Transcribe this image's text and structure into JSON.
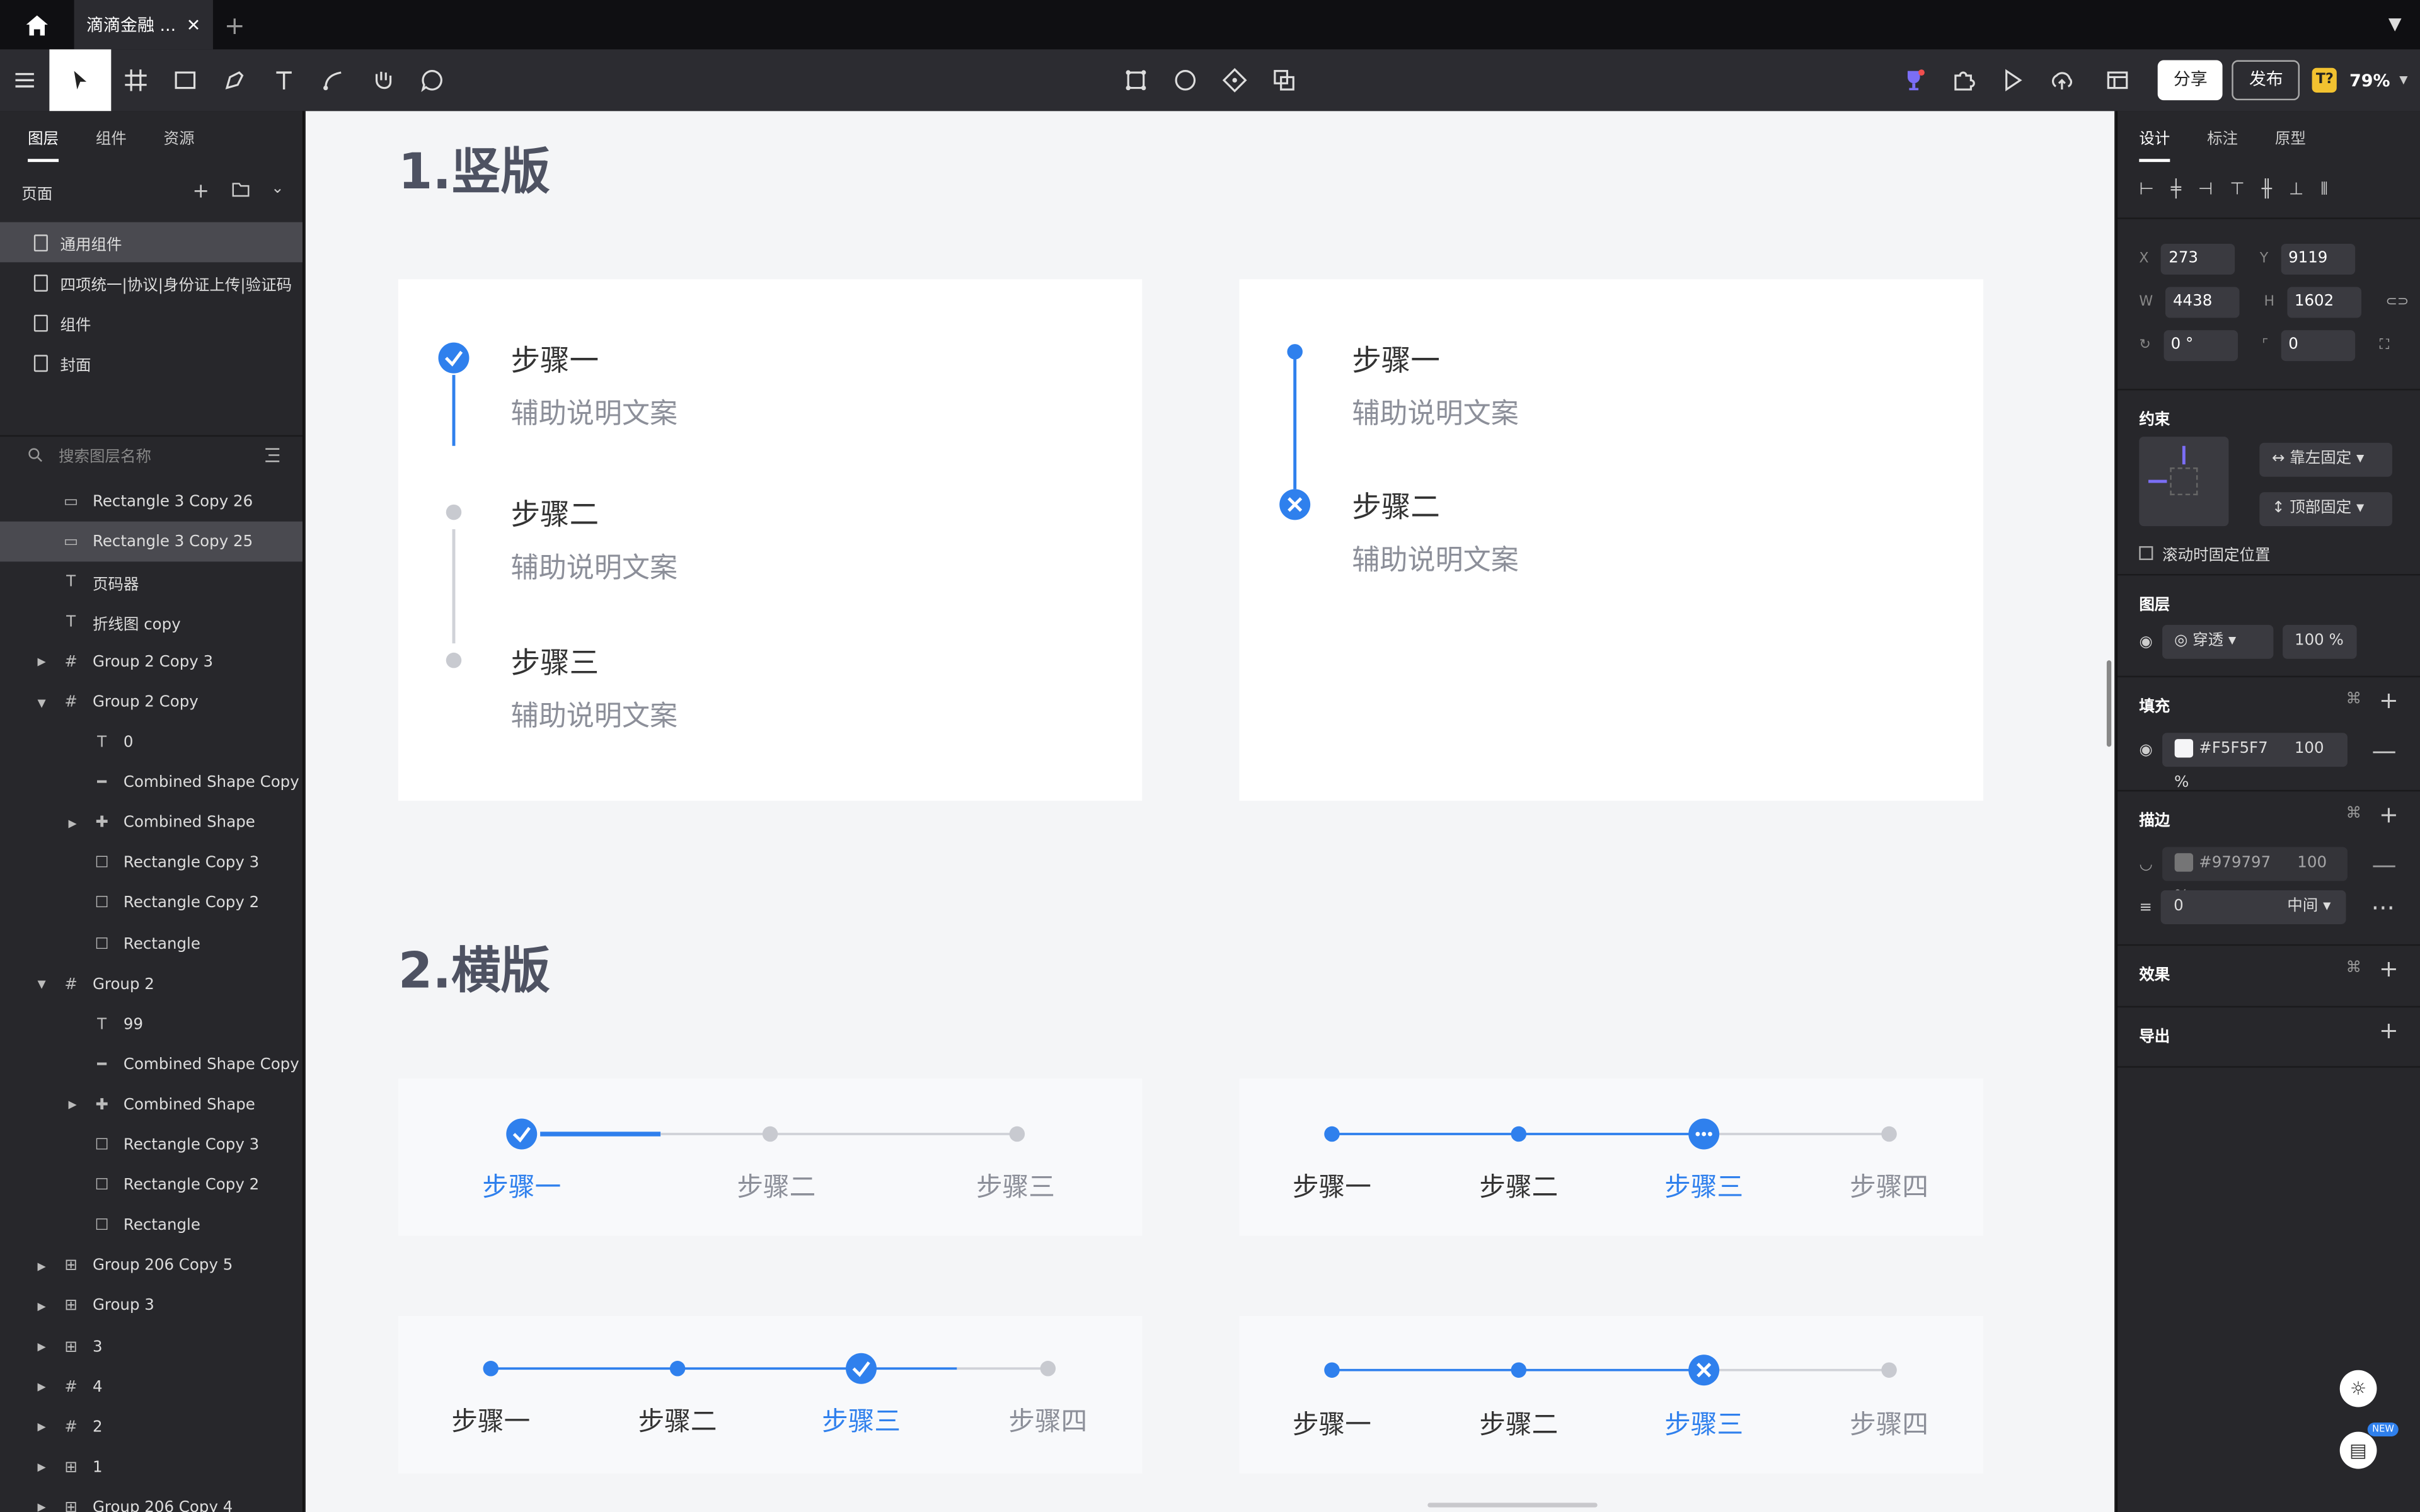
{
  "tabbar": {
    "tab_title": "滴滴金融 ...",
    "close": "✕",
    "new_tab": "+"
  },
  "toolbar": {
    "share": "分享",
    "publish": "发布",
    "plugin_badge": "T?",
    "zoom": "79%"
  },
  "left_panel": {
    "tabs": [
      "图层",
      "组件",
      "资源"
    ],
    "pages_label": "页面",
    "pages": [
      "通用组件",
      "四项统一|协议|身份证上传|验证码",
      "组件",
      "封面"
    ],
    "search_placeholder": "搜索图层名称",
    "layers": [
      {
        "name": "Rectangle 3 Copy 26",
        "icon": "rect-line"
      },
      {
        "name": "Rectangle 3 Copy 25",
        "icon": "rect-line",
        "selected": true
      },
      {
        "name": "页码器",
        "icon": "text"
      },
      {
        "name": "折线图 copy",
        "icon": "text"
      },
      {
        "name": "Group 2 Copy 3",
        "icon": "frame",
        "arrow": "right"
      },
      {
        "name": "Group 2 Copy",
        "icon": "frame",
        "arrow": "down"
      },
      {
        "name": "0",
        "icon": "text",
        "indent": 1
      },
      {
        "name": "Combined Shape Copy",
        "icon": "line",
        "indent": 1
      },
      {
        "name": "Combined Shape",
        "icon": "combined",
        "indent": 1,
        "arrow": "right"
      },
      {
        "name": "Rectangle Copy 3",
        "icon": "rect",
        "indent": 1
      },
      {
        "name": "Rectangle Copy 2",
        "icon": "rect",
        "indent": 1
      },
      {
        "name": "Rectangle",
        "icon": "rect",
        "indent": 1
      },
      {
        "name": "Group 2",
        "icon": "frame",
        "arrow": "down"
      },
      {
        "name": "99",
        "icon": "text",
        "indent": 1
      },
      {
        "name": "Combined Shape Copy",
        "icon": "line",
        "indent": 1
      },
      {
        "name": "Combined Shape",
        "icon": "combined",
        "indent": 1,
        "arrow": "right"
      },
      {
        "name": "Rectangle Copy 3",
        "icon": "rect",
        "indent": 1
      },
      {
        "name": "Rectangle Copy 2",
        "icon": "rect",
        "indent": 1
      },
      {
        "name": "Rectangle",
        "icon": "rect",
        "indent": 1
      },
      {
        "name": "Group 206 Copy 5",
        "icon": "component",
        "arrow": "right"
      },
      {
        "name": "Group 3",
        "icon": "component",
        "arrow": "right"
      },
      {
        "name": "3",
        "icon": "component",
        "arrow": "right"
      },
      {
        "name": "4",
        "icon": "frame",
        "arrow": "right"
      },
      {
        "name": "2",
        "icon": "frame",
        "arrow": "right"
      },
      {
        "name": "1",
        "icon": "component",
        "arrow": "right"
      },
      {
        "name": "Group 206 Copy 4",
        "icon": "component",
        "arrow": "right"
      }
    ]
  },
  "canvas": {
    "section1_title": "1.竖版",
    "section2_title": "2.横版",
    "vertical_card1": {
      "steps": [
        {
          "title": "步骤一",
          "desc": "辅助说明文案",
          "state": "done"
        },
        {
          "title": "步骤二",
          "desc": "辅助说明文案",
          "state": "todo"
        },
        {
          "title": "步骤三",
          "desc": "辅助说明文案",
          "state": "todo"
        }
      ]
    },
    "vertical_card2": {
      "steps": [
        {
          "title": "步骤一",
          "desc": "辅助说明文案",
          "state": "dot"
        },
        {
          "title": "步骤二",
          "desc": "辅助说明文案",
          "state": "error"
        }
      ]
    },
    "horizontal_card1": {
      "labels": [
        "步骤一",
        "步骤二",
        "步骤三"
      ]
    },
    "horizontal_card2": {
      "labels": [
        "步骤一",
        "步骤二",
        "步骤三",
        "步骤四"
      ]
    },
    "horizontal_card3": {
      "labels": [
        "步骤一",
        "步骤二",
        "步骤三",
        "步骤四"
      ]
    },
    "horizontal_card4": {
      "labels": [
        "步骤一",
        "步骤二",
        "步骤三",
        "步骤四"
      ]
    }
  },
  "right_panel": {
    "tabs": [
      "设计",
      "标注",
      "原型"
    ],
    "x_label": "X",
    "x": "273",
    "y_label": "Y",
    "y": "9119",
    "w_label": "W",
    "w": "4438",
    "h_label": "H",
    "h": "1602",
    "rotation": "0 °",
    "radius": "0",
    "constraints_title": "约束",
    "constraint_h": "靠左固定",
    "constraint_v": "顶部固定",
    "fix_on_scroll": "滚动时固定位置",
    "layer_title": "图层",
    "blend": "穿透",
    "opacity": "100 %",
    "fill_title": "填充",
    "fill_hex": "#F5F5F7",
    "fill_opacity": "100 %",
    "stroke_title": "描边",
    "stroke_hex": "#979797",
    "stroke_opacity": "100 %",
    "stroke_width": "0",
    "stroke_align": "中间",
    "effects_title": "效果",
    "export_title": "导出",
    "new_badge": "NEW"
  },
  "colors": {
    "accent": "#2F80ED",
    "inactive": "#C8CAD0",
    "fill": "#F5F5F7",
    "stroke": "#979797"
  }
}
